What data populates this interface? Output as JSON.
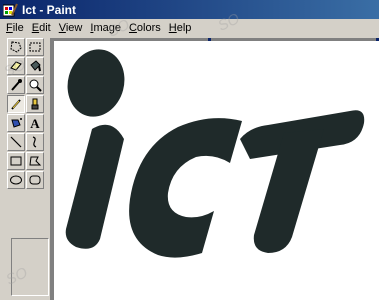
{
  "window": {
    "title": "Ict - Paint"
  },
  "menu": [
    {
      "label": "File",
      "key": "F"
    },
    {
      "label": "Edit",
      "key": "E"
    },
    {
      "label": "View",
      "key": "V"
    },
    {
      "label": "Image",
      "key": "I"
    },
    {
      "label": "Colors",
      "key": "C"
    },
    {
      "label": "Help",
      "key": "H"
    }
  ],
  "canvas": {
    "artwork_text": "ICT",
    "artwork_color": "#1f2a2a"
  },
  "toolbox": {
    "tools": [
      "free-form-select-icon",
      "select-icon",
      "eraser-icon",
      "fill-bucket-icon",
      "pick-color-icon",
      "magnifier-icon",
      "pencil-icon",
      "brush-icon",
      "airbrush-icon",
      "text-icon",
      "line-icon",
      "curve-icon",
      "rectangle-icon",
      "polygon-icon",
      "ellipse-icon",
      "rounded-rectangle-icon"
    ],
    "selected": "pencil-icon",
    "text_tool_label": "A"
  },
  "watermark": "SO"
}
